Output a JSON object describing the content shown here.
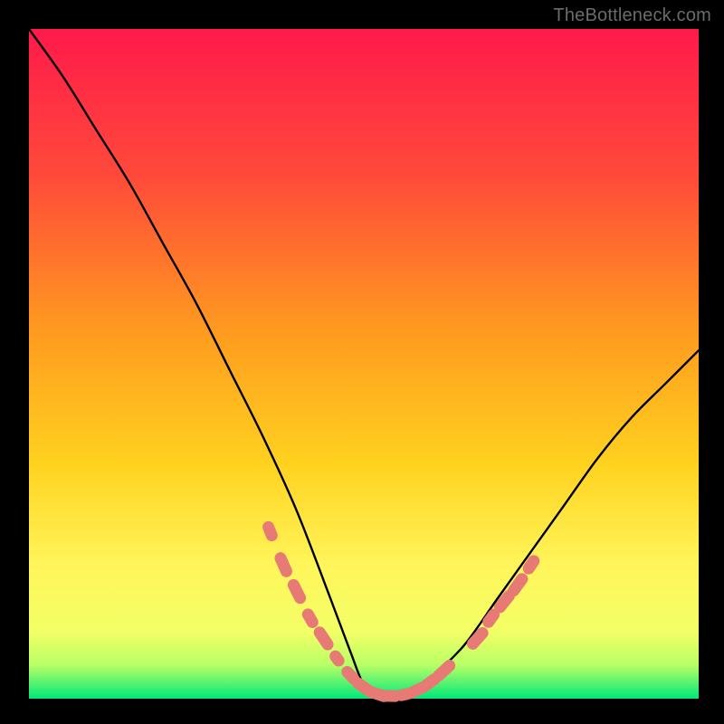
{
  "watermark": "TheBottleneck.com",
  "colors": {
    "page_bg": "#000000",
    "gradient_top": "#ff1a4b",
    "gradient_mid1": "#ff6b2b",
    "gradient_mid2": "#ffd21f",
    "gradient_mid3": "#fff55a",
    "gradient_bottom": "#00e87a",
    "curve": "#000000",
    "marker_fill": "#e77a74",
    "marker_stroke": "#d85f5a",
    "watermark": "#6b6b6b"
  },
  "chart_data": {
    "type": "line",
    "title": "",
    "xlabel": "",
    "ylabel": "",
    "xlim": [
      0,
      100
    ],
    "ylim": [
      0,
      100
    ],
    "grid": false,
    "legend": false,
    "series": [
      {
        "name": "bottleneck-curve",
        "x": [
          0,
          5,
          10,
          15,
          20,
          25,
          30,
          35,
          40,
          45,
          48,
          50,
          52,
          55,
          58,
          60,
          65,
          70,
          75,
          80,
          85,
          90,
          95,
          100
        ],
        "y": [
          100,
          93,
          85,
          77,
          68,
          59,
          49,
          39,
          28,
          15,
          7,
          2,
          0,
          0,
          1,
          3,
          8,
          15,
          22,
          29,
          36,
          42,
          47,
          52
        ]
      }
    ],
    "markers": {
      "name": "highlight-segments",
      "description": "Thick coral segments near the curve minimum",
      "points": [
        {
          "x": 36,
          "y": 25
        },
        {
          "x": 38,
          "y": 20
        },
        {
          "x": 40,
          "y": 16
        },
        {
          "x": 42,
          "y": 12
        },
        {
          "x": 44,
          "y": 9
        },
        {
          "x": 46,
          "y": 6
        },
        {
          "x": 48,
          "y": 3.5
        },
        {
          "x": 50,
          "y": 1.7
        },
        {
          "x": 52,
          "y": 0.7
        },
        {
          "x": 54,
          "y": 0.4
        },
        {
          "x": 56,
          "y": 0.6
        },
        {
          "x": 58,
          "y": 1.3
        },
        {
          "x": 60,
          "y": 2.5
        },
        {
          "x": 62,
          "y": 4.2
        },
        {
          "x": 67,
          "y": 9
        },
        {
          "x": 69,
          "y": 12
        },
        {
          "x": 71,
          "y": 14.5
        },
        {
          "x": 73,
          "y": 17
        },
        {
          "x": 75,
          "y": 20
        }
      ]
    },
    "minimum_x": 54
  }
}
